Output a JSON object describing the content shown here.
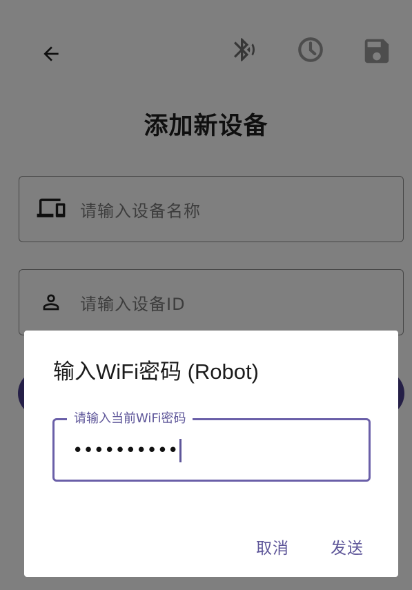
{
  "screen": {
    "title": "添加新设备",
    "fields": [
      {
        "icon": "devices-icon",
        "placeholder": "请输入设备名称"
      },
      {
        "icon": "person-icon",
        "placeholder": "请输入设备ID"
      }
    ],
    "toolbar_icons": [
      "arrow-back-icon",
      "bluetooth-icon",
      "history-icon",
      "save-icon"
    ]
  },
  "dialog": {
    "title": "输入WiFi密码 (Robot)",
    "input_label": "请输入当前WiFi密码",
    "input_value": "••••••••••",
    "cancel_label": "取消",
    "send_label": "发送"
  },
  "colors": {
    "accent": "#5e5699",
    "primary_button": "#4b3f8f",
    "scrim": "rgba(0,0,0,0.5)"
  }
}
